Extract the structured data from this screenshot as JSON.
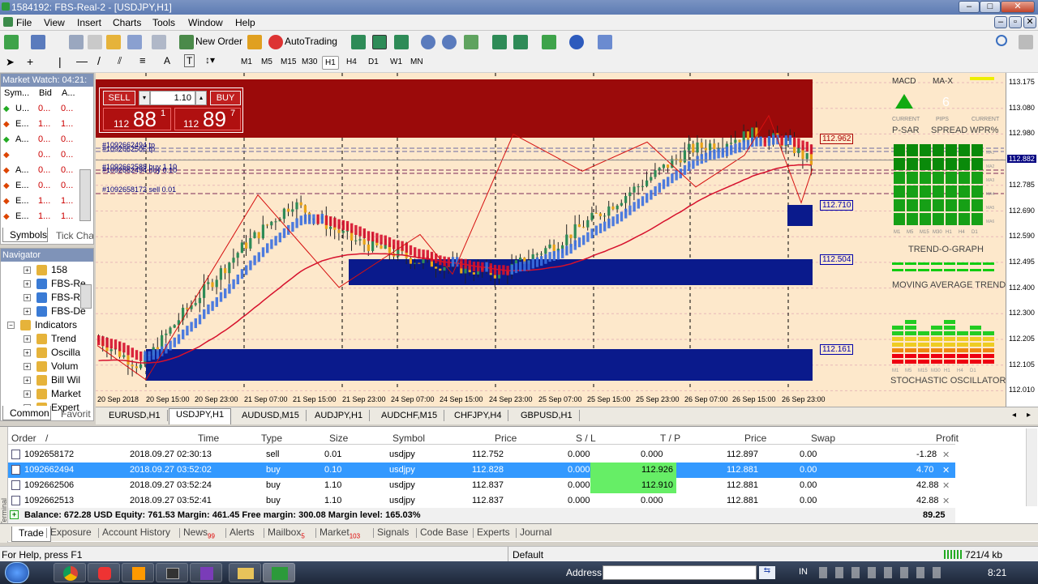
{
  "window": {
    "title": "1584192: FBS-Real-2 - [USDJPY,H1]"
  },
  "menu": [
    "File",
    "View",
    "Insert",
    "Charts",
    "Tools",
    "Window",
    "Help"
  ],
  "toolbar": {
    "new_order": "New Order",
    "autotrading": "AutoTrading"
  },
  "timeframes": [
    "M1",
    "M5",
    "M15",
    "M30",
    "H1",
    "H4",
    "D1",
    "W1",
    "MN"
  ],
  "timeframe_selected": "H1",
  "market_watch": {
    "title": "Market Watch: 04:21:",
    "columns": [
      "Sym...",
      "Bid",
      "A..."
    ],
    "rows": [
      {
        "sym": "U...",
        "bid": "0...",
        "ask": "0..."
      },
      {
        "sym": "E...",
        "bid": "1...",
        "ask": "1..."
      },
      {
        "sym": "A...",
        "bid": "0...",
        "ask": "0..."
      },
      {
        "sym": "",
        "bid": "0...",
        "ask": "0..."
      },
      {
        "sym": "A...",
        "bid": "0...",
        "ask": "0..."
      },
      {
        "sym": "E...",
        "bid": "0...",
        "ask": "0..."
      },
      {
        "sym": "E...",
        "bid": "1...",
        "ask": "1..."
      },
      {
        "sym": "E...",
        "bid": "1...",
        "ask": "1..."
      }
    ],
    "tabs": [
      "Symbols",
      "Tick Cha"
    ]
  },
  "navigator": {
    "title": "Navigator",
    "items": [
      "158",
      "FBS-Re",
      "FBS-Re",
      "FBS-De",
      "Indicators",
      "Trend",
      "Oscilla",
      "Volum",
      "Bill Wil",
      "Market",
      "Expert"
    ],
    "tabs": [
      "Common",
      "Favorit"
    ]
  },
  "trade_panel": {
    "sell": "SELL",
    "buy": "BUY",
    "lot": "1.10",
    "sell_price_small": "112",
    "sell_price_big": "88",
    "sell_price_sup": "1",
    "buy_price_small": "112",
    "buy_price_big": "89",
    "buy_price_sup": "7"
  },
  "chart_labels": {
    "order1": "#1092662494 tp",
    "order2": "#1092662506 tp",
    "order3": "#1092662588 buy 1.10",
    "order4": "#1092662494 buy 0.10",
    "order5": "#1092658172 sell 0.01",
    "level_a": "112.962",
    "level_b": "112.710",
    "level_c": "112.504",
    "level_d": "112.161",
    "current": "112.882"
  },
  "indicator_panel": {
    "macd": "MACD",
    "max": "MA-X",
    "current1": "CURRENT",
    "pips": "PIPS",
    "current2": "CURRENT",
    "psar": "P-SAR",
    "spread": "SPREAD",
    "wpr": "WPR%",
    "spread_value": "6",
    "trendograph": "TREND-O-GRAPH",
    "moving_avg": "MOVING AVERAGE TREND",
    "stochastic": "STOCHASTIC OSCILLATORS",
    "tf_row": [
      "M1",
      "M5",
      "M15",
      "M30",
      "H1",
      "H4",
      "D1"
    ],
    "ma_row": [
      "MA1",
      "MA2",
      "MA3",
      "MA4",
      "MA5",
      "MA6"
    ]
  },
  "y_axis": [
    "113.175",
    "113.080",
    "112.980",
    "112.875",
    "112.785",
    "112.690",
    "112.590",
    "112.495",
    "112.400",
    "112.300",
    "112.205",
    "112.105",
    "112.010"
  ],
  "x_axis": [
    "20 Sep 2018",
    "20 Sep 15:00",
    "20 Sep 23:00",
    "21 Sep 07:00",
    "21 Sep 15:00",
    "21 Sep 23:00",
    "24 Sep 07:00",
    "24 Sep 15:00",
    "24 Sep 23:00",
    "25 Sep 07:00",
    "25 Sep 15:00",
    "25 Sep 23:00",
    "26 Sep 07:00",
    "26 Sep 15:00",
    "26 Sep 23:00"
  ],
  "chart_tabs": [
    "EURUSD,H1",
    "USDJPY,H1",
    "AUDUSD,M15",
    "AUDJPY,H1",
    "AUDCHF,M15",
    "CHFJPY,H4",
    "GBPUSD,H1"
  ],
  "chart_tab_selected": "USDJPY,H1",
  "terminal": {
    "headers": [
      "Order",
      "/",
      "Time",
      "Type",
      "Size",
      "Symbol",
      "Price",
      "S / L",
      "T / P",
      "Price",
      "Swap",
      "Profit"
    ],
    "rows": [
      {
        "order": "1092658172",
        "time": "2018.09.27 02:30:13",
        "type": "sell",
        "size": "0.01",
        "symbol": "usdjpy",
        "price": "112.752",
        "sl": "0.000",
        "tp": "0.000",
        "cur": "112.897",
        "swap": "0.00",
        "profit": "-1.28"
      },
      {
        "order": "1092662494",
        "time": "2018.09.27 03:52:02",
        "type": "buy",
        "size": "0.10",
        "symbol": "usdjpy",
        "price": "112.828",
        "sl": "0.000",
        "tp": "112.926",
        "cur": "112.881",
        "swap": "0.00",
        "profit": "4.70"
      },
      {
        "order": "1092662506",
        "time": "2018.09.27 03:52:24",
        "type": "buy",
        "size": "1.10",
        "symbol": "usdjpy",
        "price": "112.837",
        "sl": "0.000",
        "tp": "112.910",
        "cur": "112.881",
        "swap": "0.00",
        "profit": "42.88"
      },
      {
        "order": "1092662513",
        "time": "2018.09.27 03:52:41",
        "type": "buy",
        "size": "1.10",
        "symbol": "usdjpy",
        "price": "112.837",
        "sl": "0.000",
        "tp": "0.000",
        "cur": "112.881",
        "swap": "0.00",
        "profit": "42.88"
      }
    ],
    "balance_line": "Balance: 672.28 USD  Equity: 761.53  Margin: 461.45  Free margin: 300.08  Margin level: 165.03%",
    "total_profit": "89.25",
    "tabs": [
      {
        "label": "Trade",
        "badge": ""
      },
      {
        "label": "Exposure",
        "badge": ""
      },
      {
        "label": "Account History",
        "badge": ""
      },
      {
        "label": "News",
        "badge": "99"
      },
      {
        "label": "Alerts",
        "badge": ""
      },
      {
        "label": "Mailbox",
        "badge": "5"
      },
      {
        "label": "Market",
        "badge": "103"
      },
      {
        "label": "Signals",
        "badge": ""
      },
      {
        "label": "Code Base",
        "badge": ""
      },
      {
        "label": "Experts",
        "badge": ""
      },
      {
        "label": "Journal",
        "badge": ""
      }
    ],
    "side_label": "Terminal"
  },
  "status": {
    "help": "For Help, press F1",
    "profile": "Default",
    "traffic": "721/4 kb"
  },
  "taskbar": {
    "address_label": "Address",
    "lang": "IN",
    "time": "8:21"
  },
  "colors": {
    "chart_bg": "#fde8cb",
    "bull": "#2e8b57",
    "bear": "#e8a317",
    "blue_zone": "#0a1a8c",
    "red_zone": "#9b0a0a",
    "ma_red": "#d6102c",
    "ma_blue": "#3a6fe0",
    "highlight": "#3399ff",
    "tp_green": "#66ee66"
  }
}
